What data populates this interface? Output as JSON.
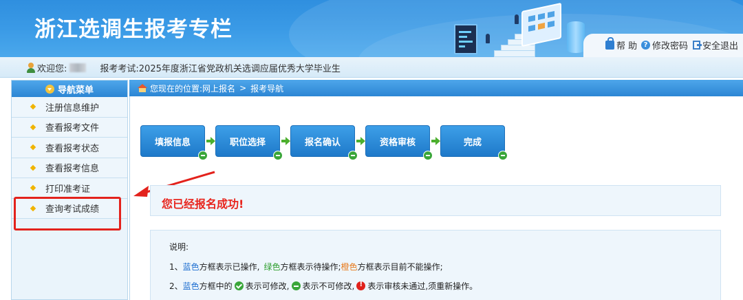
{
  "header": {
    "title": "浙江选调生报考专栏",
    "links": [
      {
        "label": "帮 助",
        "icon": "lock-icon"
      },
      {
        "label": "修改密码",
        "icon": "help-icon"
      },
      {
        "label": "安全退出",
        "icon": "exit-icon"
      }
    ]
  },
  "welcome": {
    "greeting": "欢迎您:",
    "exam_label": "报考考试:",
    "exam_name": "2025年度浙江省党政机关选调应届优秀大学毕业生"
  },
  "sidebar": {
    "title": "导航菜单",
    "items": [
      {
        "label": "注册信息维护"
      },
      {
        "label": "查看报考文件"
      },
      {
        "label": "查看报考状态"
      },
      {
        "label": "查看报考信息"
      },
      {
        "label": "打印准考证"
      },
      {
        "label": "查询考试成绩"
      }
    ]
  },
  "breadcrumb": {
    "prefix": "您现在的位置:",
    "path": [
      "网上报名",
      "报考导航"
    ],
    "separator": ">"
  },
  "steps": [
    {
      "label": "填报信息"
    },
    {
      "label": "职位选择"
    },
    {
      "label": "报名确认"
    },
    {
      "label": "资格审核"
    },
    {
      "label": "完成"
    }
  ],
  "success": {
    "message": "您已经报名成功!"
  },
  "notes": {
    "heading": "说明:",
    "line1": {
      "n": "1、",
      "blue": "蓝色",
      "t1": "方框表示已操作,",
      "green": "绿色",
      "t2": "方框表示待操作;",
      "orange": "橙色",
      "t3": "方框表示目前不能操作;"
    },
    "line2": {
      "n": "2、",
      "blue": "蓝色",
      "t1": "方框中的",
      "t2": "表示可修改,",
      "t3": "表示不可修改,",
      "t4": "表示审核未通过,须重新操作。"
    }
  },
  "colors": {
    "header": "#3a9ae6",
    "step_blue": "#2584d2",
    "success_red": "#e8241c",
    "highlight_red": "#e3221c"
  }
}
